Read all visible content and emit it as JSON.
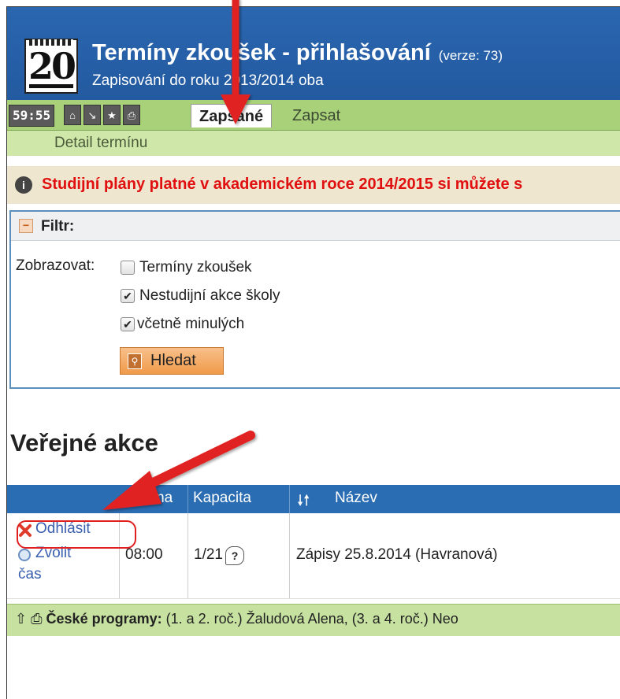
{
  "header": {
    "logo_text": "20",
    "title": "Termíny zkoušek - přihlašování",
    "version": "(verze: 73)",
    "subtitle": "Zapisování do roku 2013/2014 oba"
  },
  "tabbar": {
    "timer": "59:55",
    "icons": [
      "home-icon",
      "download-icon",
      "star-icon",
      "print-icon"
    ],
    "tabs": [
      {
        "label": "Zapsané",
        "active": true
      },
      {
        "label": "Zapsat",
        "active": false
      }
    ],
    "sub_link": "Detail termínu"
  },
  "warning": {
    "icon": "info-icon",
    "text": "Studijní plány platné v akademickém roce 2014/2015 si můžete s"
  },
  "filter": {
    "title": "Filtr:",
    "show_label": "Zobrazovat:",
    "options": [
      {
        "label": "Termíny zkoušek",
        "checked": false
      },
      {
        "label": "Nestudijní akce školy",
        "checked": true
      },
      {
        "label": "včetně minulých",
        "checked": true
      }
    ],
    "search_button": "Hledat"
  },
  "section": {
    "title": "Veřejné akce"
  },
  "table": {
    "headers": [
      "Hodina",
      "Kapacita",
      "Název"
    ],
    "sort_icon": "sort-arrows-icon",
    "rows": [
      {
        "action_unregister": "Odhlásit",
        "action_choose_time_1": "Zvolit",
        "action_choose_time_2": "čas",
        "hour": "08:00",
        "capacity": "1/21",
        "name": "Zápisy 25.8.2014 (Havranová)"
      }
    ]
  },
  "footer": {
    "label": "České programy:",
    "text": " (1. a 2. roč.) Žaludová Alena,  (3. a 4. roč.) Neo"
  },
  "colors": {
    "header_blue": "#2a66b0",
    "tab_green": "#a8d17a",
    "warning_red": "#e01010",
    "annotation_red": "#e02020"
  }
}
